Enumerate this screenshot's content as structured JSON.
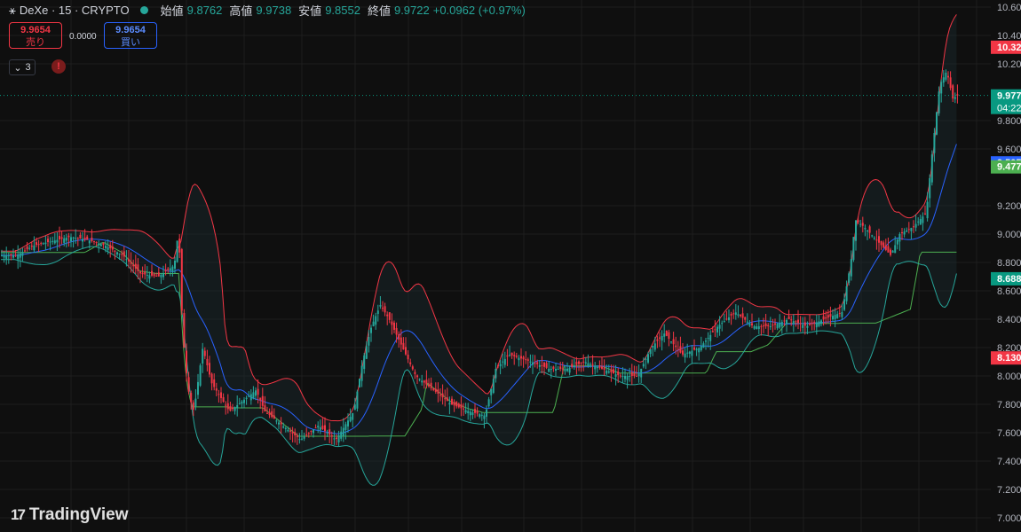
{
  "header": {
    "symbol": "DeXe · 15 · CRYPTO",
    "open_label": "始値",
    "open": "9.8762",
    "high_label": "高値",
    "high": "9.9738",
    "low_label": "安値",
    "low": "9.8552",
    "close_label": "終値",
    "close": "9.9722",
    "change": "+0.0962 (+0.97%)"
  },
  "trade": {
    "sell_price": "9.9654",
    "sell_label": "売り",
    "buy_price": "9.9654",
    "buy_label": "買い",
    "spread": "0.0000"
  },
  "indicators": {
    "collapsed_count": "3",
    "warning": "!"
  },
  "branding": {
    "logo_text": "TradingView"
  },
  "colors": {
    "background": "#0f0f0f",
    "up": "#26a69a",
    "down": "#f23645",
    "upper_band": "#f23645",
    "lower_band": "#26a69a",
    "mid_band": "#2962ff",
    "bb_green": "#4caf50",
    "grid": "#1e1e1e"
  },
  "chart_data": {
    "type": "candlestick",
    "ylim": [
      7.0,
      10.6
    ],
    "yticks": [
      "10.600",
      "10.400",
      "10.200",
      "9.800",
      "9.600",
      "9.200",
      "9.000",
      "8.800",
      "8.600",
      "8.400",
      "8.200",
      "8.000",
      "7.800",
      "7.600",
      "7.400",
      "7.200",
      "7.000"
    ],
    "price_labels": [
      {
        "value": "10.32",
        "price": 10.32,
        "color": "#f23645"
      },
      {
        "value": "9.977",
        "sub": "04:22",
        "price": 9.977,
        "color": "#089981"
      },
      {
        "value": "9.505",
        "price": 9.505,
        "color": "#2962ff"
      },
      {
        "value": "9.477",
        "price": 9.477,
        "color": "#4caf50"
      },
      {
        "value": "8.688",
        "price": 8.688,
        "color": "#089981"
      },
      {
        "value": "8.130",
        "price": 8.13,
        "color": "#f23645"
      }
    ],
    "last_price": 9.977,
    "close_path": [
      [
        0,
        8.85
      ],
      [
        20,
        8.85
      ],
      [
        40,
        8.92
      ],
      [
        60,
        8.95
      ],
      [
        80,
        8.98
      ],
      [
        100,
        8.96
      ],
      [
        120,
        8.92
      ],
      [
        140,
        8.85
      ],
      [
        160,
        8.72
      ],
      [
        180,
        8.7
      ],
      [
        198,
        8.78
      ],
      [
        203,
        9.05
      ],
      [
        205,
        8.6
      ],
      [
        210,
        8.1
      ],
      [
        215,
        7.85
      ],
      [
        220,
        7.75
      ],
      [
        230,
        8.2
      ],
      [
        240,
        7.95
      ],
      [
        260,
        7.75
      ],
      [
        280,
        7.85
      ],
      [
        290,
        7.9
      ],
      [
        300,
        7.75
      ],
      [
        320,
        7.65
      ],
      [
        340,
        7.55
      ],
      [
        360,
        7.65
      ],
      [
        380,
        7.55
      ],
      [
        400,
        7.75
      ],
      [
        410,
        8.1
      ],
      [
        420,
        8.35
      ],
      [
        430,
        8.5
      ],
      [
        440,
        8.4
      ],
      [
        455,
        8.2
      ],
      [
        470,
        8.0
      ],
      [
        490,
        7.9
      ],
      [
        510,
        7.8
      ],
      [
        530,
        7.75
      ],
      [
        548,
        7.72
      ],
      [
        560,
        8.05
      ],
      [
        575,
        8.15
      ],
      [
        600,
        8.1
      ],
      [
        620,
        8.05
      ],
      [
        640,
        8.05
      ],
      [
        660,
        8.1
      ],
      [
        680,
        8.05
      ],
      [
        700,
        8.0
      ],
      [
        720,
        8.0
      ],
      [
        735,
        8.2
      ],
      [
        750,
        8.3
      ],
      [
        770,
        8.15
      ],
      [
        790,
        8.2
      ],
      [
        810,
        8.35
      ],
      [
        830,
        8.45
      ],
      [
        850,
        8.35
      ],
      [
        870,
        8.35
      ],
      [
        890,
        8.4
      ],
      [
        910,
        8.35
      ],
      [
        930,
        8.4
      ],
      [
        950,
        8.45
      ],
      [
        960,
        8.8
      ],
      [
        965,
        9.1
      ],
      [
        975,
        9.05
      ],
      [
        990,
        8.95
      ],
      [
        1005,
        8.85
      ],
      [
        1015,
        9.0
      ],
      [
        1030,
        9.05
      ],
      [
        1045,
        9.15
      ],
      [
        1052,
        9.6
      ],
      [
        1060,
        10.05
      ],
      [
        1068,
        10.15
      ],
      [
        1075,
        9.95
      ],
      [
        1079,
        9.977
      ]
    ]
  }
}
